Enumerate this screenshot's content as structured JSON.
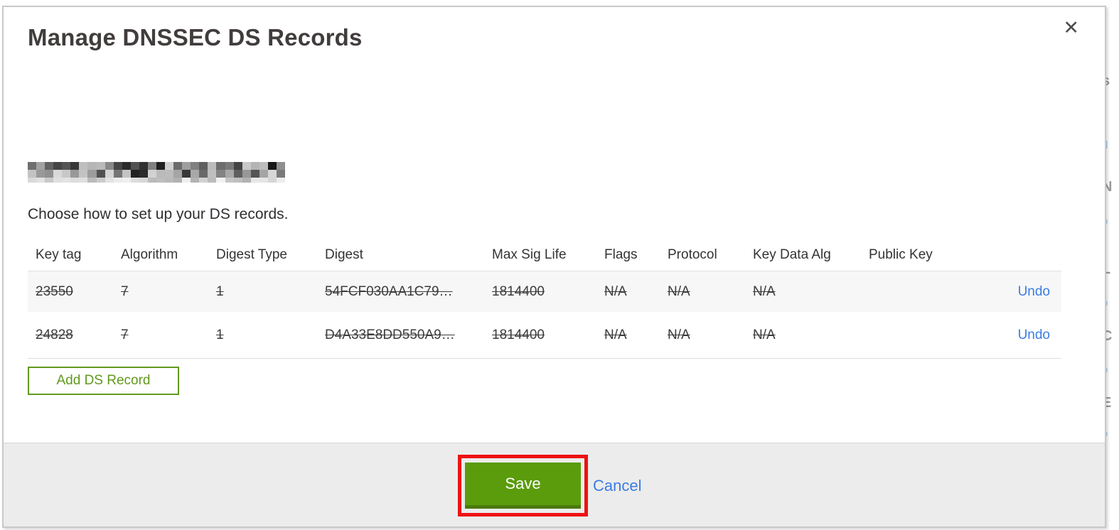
{
  "modal": {
    "title": "Manage DNSSEC DS Records",
    "close_icon": "✕",
    "domain_redacted": true,
    "instruction": "Choose how to set up your DS records.",
    "table": {
      "headers": [
        "Key tag",
        "Algorithm",
        "Digest Type",
        "Digest",
        "Max Sig Life",
        "Flags",
        "Protocol",
        "Key Data Alg",
        "Public Key"
      ],
      "rows": [
        {
          "key_tag": "23550",
          "algorithm": "7",
          "digest_type": "1",
          "digest": "54FCF030AA1C79…",
          "max_sig_life": "1814400",
          "flags": "N/A",
          "protocol": "N/A",
          "key_data_alg": "N/A",
          "public_key": "",
          "action": "Undo",
          "state": "marked-for-deletion"
        },
        {
          "key_tag": "24828",
          "algorithm": "7",
          "digest_type": "1",
          "digest": "D4A33E8DD550A9…",
          "max_sig_life": "1814400",
          "flags": "N/A",
          "protocol": "N/A",
          "key_data_alg": "N/A",
          "public_key": "",
          "action": "Undo",
          "state": "marked-for-deletion"
        }
      ]
    },
    "add_button_label": "Add DS Record",
    "footer": {
      "save_label": "Save",
      "cancel_label": "Cancel"
    }
  },
  "background_page_edge": {
    "fragments": [
      "s",
      "d",
      "N",
      "o",
      "L",
      "o",
      "C",
      "o",
      "E",
      "o"
    ]
  },
  "colors": {
    "accent_green": "#5a9c0b",
    "accent_green_dark": "#4a7a0c",
    "outline_green": "#61991d",
    "link_blue": "#3b7de2",
    "annotation_red": "#ee1212",
    "footer_gray": "#ececec",
    "row_stripe_gray": "#f7f7f7"
  }
}
